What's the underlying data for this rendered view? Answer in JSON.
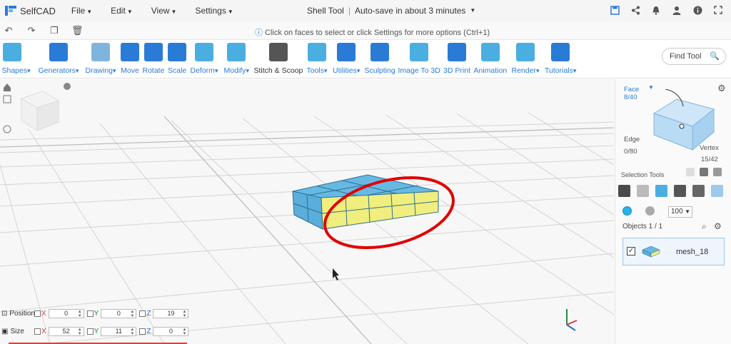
{
  "app": {
    "name": "SelfCAD"
  },
  "menu": [
    {
      "label": "File"
    },
    {
      "label": "Edit"
    },
    {
      "label": "View"
    },
    {
      "label": "Settings"
    }
  ],
  "doc": {
    "tool_name": "Shell Tool",
    "autosave": "Auto-save in about 3 minutes"
  },
  "hint": "Click on faces to select or click Settings for more options (Ctrl+1)",
  "toolbar": [
    {
      "label": "D Shapes",
      "icon": "cube-icon",
      "caret": true
    },
    {
      "label": "Generators",
      "icon": "generator-icon",
      "caret": true
    },
    {
      "label": "Drawing",
      "icon": "drawing-icon",
      "caret": true
    },
    {
      "label": "Move",
      "icon": "move-icon",
      "caret": false
    },
    {
      "label": "Rotate",
      "icon": "rotate-icon",
      "caret": false
    },
    {
      "label": "Scale",
      "icon": "scale-icon",
      "caret": false
    },
    {
      "label": "Deform",
      "icon": "deform-icon",
      "caret": true
    },
    {
      "label": "Modify",
      "icon": "modify-icon",
      "caret": true
    },
    {
      "label": "Stitch & Scoop",
      "icon": "stitch-scoop-icon",
      "caret": false
    },
    {
      "label": "Tools",
      "icon": "tools-icon",
      "caret": true
    },
    {
      "label": "Utilities",
      "icon": "utilities-icon",
      "caret": true
    },
    {
      "label": "Sculpting",
      "icon": "sculpting-icon",
      "caret": false
    },
    {
      "label": "Image To 3D",
      "icon": "image-to-3d-icon",
      "caret": false
    },
    {
      "label": "3D Print",
      "icon": "printer-icon",
      "caret": false
    },
    {
      "label": "Animation",
      "icon": "animation-icon",
      "caret": false
    },
    {
      "label": "Render",
      "icon": "render-icon",
      "caret": true
    },
    {
      "label": "Tutorials",
      "icon": "tutorials-icon",
      "caret": true
    }
  ],
  "find_tool": {
    "placeholder": "Find Tool"
  },
  "panel": {
    "face_label": "Face",
    "face_count": "8/40",
    "edge_label": "Edge",
    "edge_count": "0/80",
    "vertex_label": "Vertex",
    "vertex_count": "15/42",
    "selection_tools": "Selection Tools",
    "quantity": "100",
    "objects_label": "Objects 1 / 1",
    "object_name": "mesh_18"
  },
  "coords": {
    "position_label": "Position",
    "size_label": "Size",
    "position": {
      "x": "0",
      "y": "0",
      "z": "19"
    },
    "size": {
      "x": "52",
      "y": "11",
      "z": "0"
    }
  },
  "colors": {
    "accent": "#2a7bd6",
    "mesh_blue": "#5ab4e0",
    "face_selected": "#f0ee7e",
    "annotation_red": "#e00000"
  }
}
